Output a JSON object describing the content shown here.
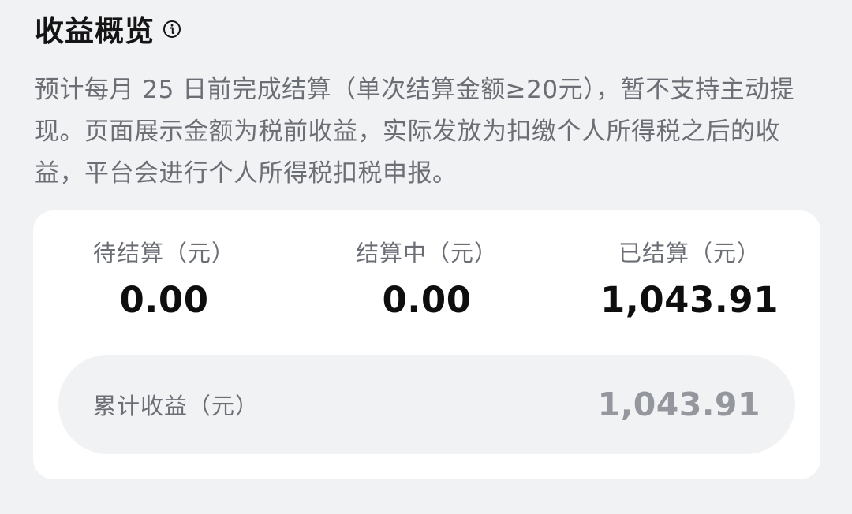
{
  "header": {
    "title": "收益概览",
    "info_icon": "info-icon"
  },
  "description": "预计每月 25 日前完成结算（单次结算金额≥20元），暂不支持主动提现。页面展示金额为税前收益，实际发放为扣缴个人所得税之后的收益，平台会进行个人所得税扣税申报。",
  "stats": [
    {
      "label": "待结算（元）",
      "value": "0.00"
    },
    {
      "label": "结算中（元）",
      "value": "0.00"
    },
    {
      "label": "已结算（元）",
      "value": "1,043.91"
    }
  ],
  "total": {
    "label": "累计收益（元）",
    "value": "1,043.91"
  },
  "colors": {
    "background": "#f1f2f4",
    "card": "#ffffff",
    "primary_text": "#111111",
    "secondary_text": "#6b6e75",
    "muted_value": "#94979d"
  }
}
